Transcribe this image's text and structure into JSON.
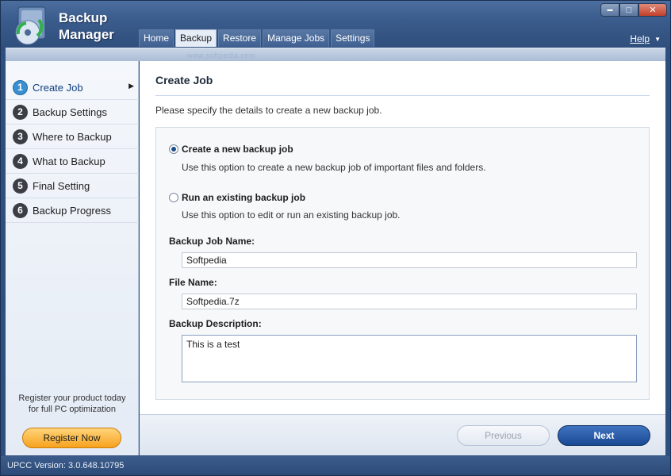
{
  "app": {
    "title_line1": "Backup",
    "title_line2": "Manager",
    "watermark": "www.softpedia.com"
  },
  "window_controls": {
    "minimize_glyph": "▬",
    "maximize_glyph": "□",
    "close_glyph": "✕"
  },
  "tabs": [
    {
      "label": "Home"
    },
    {
      "label": "Backup",
      "active": true
    },
    {
      "label": "Restore"
    },
    {
      "label": "Manage Jobs"
    },
    {
      "label": "Settings"
    }
  ],
  "help": {
    "label": "Help",
    "arrow": "▼"
  },
  "sidebar": {
    "steps": [
      {
        "num": "1",
        "label": "Create Job",
        "active": true
      },
      {
        "num": "2",
        "label": "Backup Settings"
      },
      {
        "num": "3",
        "label": "Where to Backup"
      },
      {
        "num": "4",
        "label": "What to Backup"
      },
      {
        "num": "5",
        "label": "Final Setting"
      },
      {
        "num": "6",
        "label": "Backup Progress"
      }
    ],
    "promo_line1": "Register your product today",
    "promo_line2": "for full PC optimization",
    "register_label": "Register Now"
  },
  "main": {
    "heading": "Create Job",
    "description": "Please specify the details to create a new backup job.",
    "options": [
      {
        "label": "Create a new backup job",
        "help": "Use this option to create a new backup job of important files and folders.",
        "checked": true
      },
      {
        "label": "Run an existing backup job",
        "help": "Use this option to edit or run an existing backup job.",
        "checked": false
      }
    ],
    "job_name": {
      "label": "Backup Job Name:",
      "value": "Softpedia"
    },
    "file_name": {
      "label": "File Name:",
      "value": "Softpedia.7z"
    },
    "description_field": {
      "label": "Backup Description:",
      "value": "This is a test"
    }
  },
  "footer": {
    "previous_label": "Previous",
    "next_label": "Next"
  },
  "status": {
    "version_text": "UPCC Version: 3.0.648.10795"
  },
  "colors": {
    "frame": "#2f4f7f",
    "accent_blue": "#1b4a94",
    "register_orange": "#f7a21e",
    "active_step": "#3a8fd0"
  }
}
